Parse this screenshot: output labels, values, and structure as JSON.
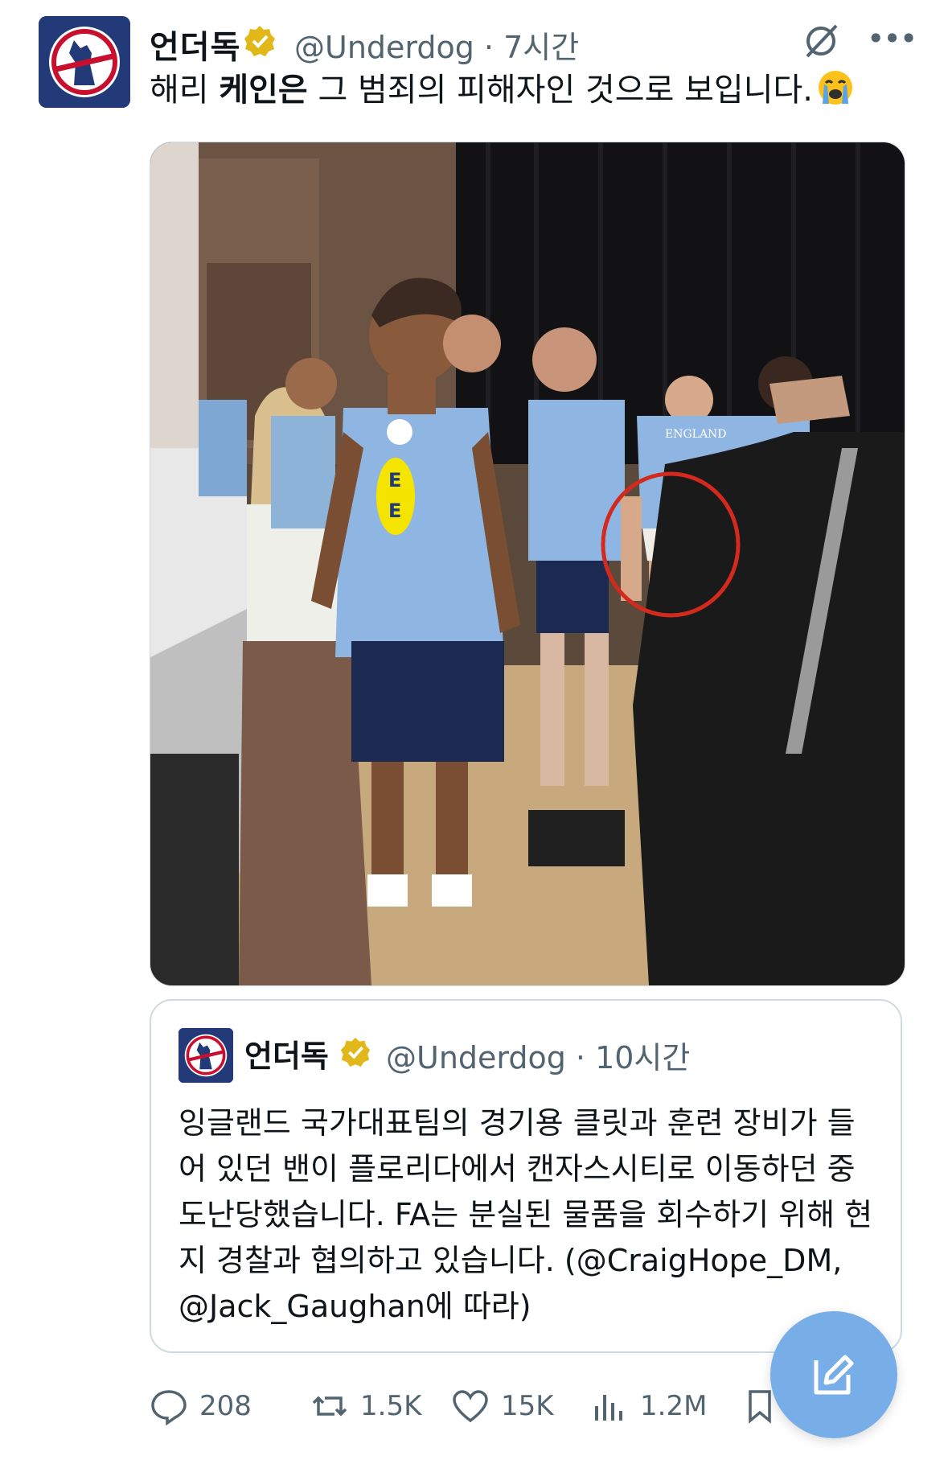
{
  "tweet": {
    "author_name": "언더독",
    "handle_time": "@Underdog · 7시간",
    "text_part1": "해리 ",
    "text_bold": "케인은",
    "text_part2": " 그 범죄의 피해자인 것으로 보입니다.",
    "emoji": "loudly-crying-face"
  },
  "photo": {
    "jersey_text": "ENGLAND",
    "sponsor": "E E"
  },
  "quoted_tweet": {
    "author_name": "언더독",
    "handle_time": "@Underdog · 10시간",
    "text": "잉글랜드 국가대표팀의 경기용 클릿과 훈련 장비가 들어 있던 밴이 플로리다에서 캔자스시티로 이동하던 중 도난당했습니다. FA는 분실된 물품을 회수하기 위해 현지 경찰과 협의하고 있습니다. (@CraigHope_DM, @Jack_Gaughan에 따라)"
  },
  "actions": {
    "replies": "208",
    "reposts": "1.5K",
    "likes": "15K",
    "views": "1.2M"
  },
  "icons": [
    "verified-badge-icon",
    "grok-icon",
    "more-icon",
    "reply-icon",
    "repost-icon",
    "like-icon",
    "views-icon",
    "bookmark-icon",
    "share-icon",
    "compose-icon"
  ],
  "colors": {
    "accent": "#1d9bf0",
    "fab": "#78aee8",
    "muted": "#536471",
    "verified": "#e2b719",
    "circle": "#d42a1e"
  }
}
